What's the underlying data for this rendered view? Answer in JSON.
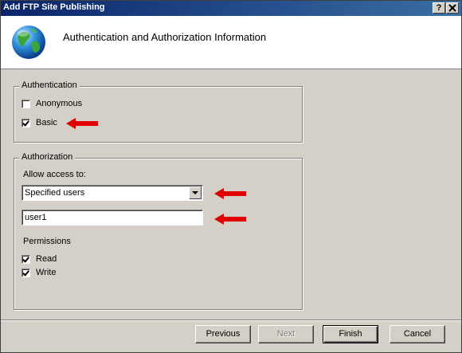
{
  "window": {
    "title": "Add FTP Site Publishing",
    "help_button": "?",
    "close_button": "X"
  },
  "header": {
    "title": "Authentication and Authorization Information"
  },
  "authentication": {
    "legend": "Authentication",
    "anonymous": {
      "label": "Anonymous",
      "checked": false
    },
    "basic": {
      "label": "Basic",
      "checked": true
    }
  },
  "authorization": {
    "legend": "Authorization",
    "allow_label": "Allow access to:",
    "allow_value": "Specified users",
    "users_value": "user1",
    "permissions_label": "Permissions",
    "read": {
      "label": "Read",
      "checked": true
    },
    "write": {
      "label": "Write",
      "checked": true
    }
  },
  "buttons": {
    "previous": "Previous",
    "next": "Next",
    "finish": "Finish",
    "cancel": "Cancel"
  },
  "colors": {
    "titlebar_start": "#0a246a",
    "titlebar_end": "#3a6ea5",
    "arrow": "#e00000",
    "dialog_bg": "#d4d0c8"
  }
}
